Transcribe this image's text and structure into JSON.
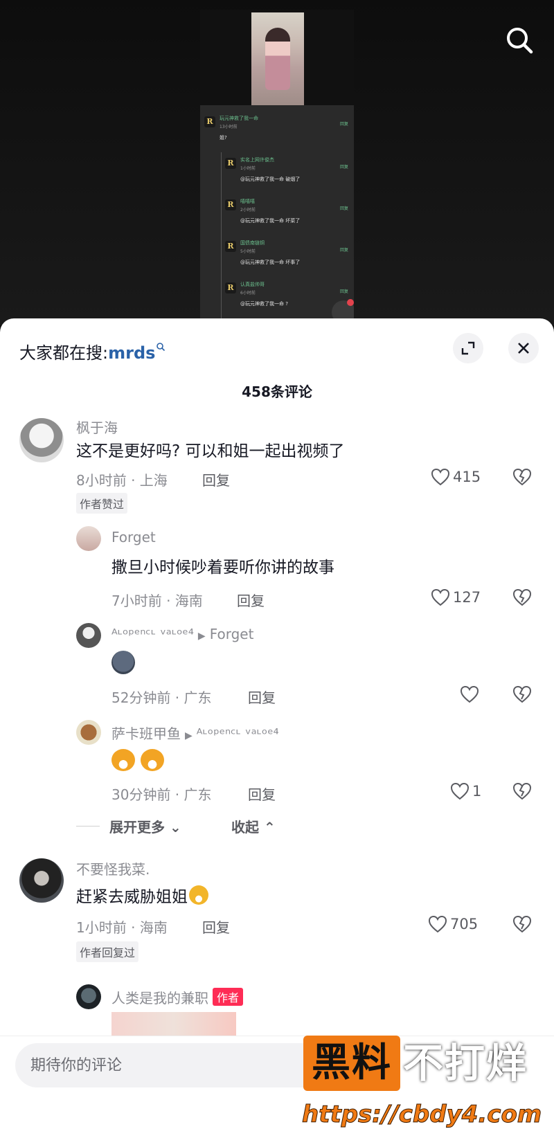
{
  "embedded_screenshot": {
    "items": [
      {
        "name": "玩元神救了我一命",
        "time": "13小时前",
        "text": "姐?",
        "action": "回复"
      },
      {
        "name": "实名上网许俊杰",
        "time": "1小时前",
        "text": "@玩元神救了我一命 破烟了",
        "action": "回复"
      },
      {
        "name": "嘻嘻嘻",
        "time": "2小时前",
        "text": "@玩元神救了我一命 坏菜了",
        "action": "回复"
      },
      {
        "name": "国债南链铜",
        "time": "5小时前",
        "text": "@玩元神救了我一命 坏事了",
        "action": "回复"
      },
      {
        "name": "认真盐帅哥",
        "time": "6小时前",
        "text": "@玩元神救了我一命 ?",
        "action": "回复"
      }
    ],
    "avatar_letter": "R"
  },
  "sheet": {
    "hot_search_prefix": "大家都在搜:",
    "hot_search_keyword": "mrds",
    "comment_count": "458条评论"
  },
  "comments": {
    "c1": {
      "user": "枫于海",
      "text": "这不是更好吗? 可以和姐一起出视频了",
      "meta": "8小时前 · 上海",
      "reply": "回复",
      "likes": "415",
      "tag": "作者赞过"
    },
    "r1": {
      "user": "Forget",
      "text": "撒旦小时候吵着要听你讲的故事",
      "meta": "7小时前 · 海南",
      "reply": "回复",
      "likes": "127"
    },
    "r2": {
      "user": "ᴬᶫᵒᵖᵉⁿᶜᶫ ᵛᵃᶫᵒᵉ⁴",
      "to": "Forget",
      "meta": "52分钟前 · 广东",
      "reply": "回复",
      "likes": ""
    },
    "r3": {
      "user": "萨卡班甲鱼",
      "to": "ᴬᶫᵒᵖᵉⁿᶜᶫ ᵛᵃᶫᵒᵉ⁴",
      "meta": "30分钟前 · 广东",
      "reply": "回复",
      "likes": "1"
    },
    "expand": "展开更多",
    "collapse": "收起",
    "c2": {
      "user": "不要怪我菜.",
      "text": "赶紧去威胁姐姐",
      "meta": "1小时前 · 海南",
      "reply": "回复",
      "likes": "705",
      "tag": "作者回复过"
    },
    "r4": {
      "user": "人类是我的兼职",
      "badge": "作者"
    }
  },
  "input": {
    "placeholder": "期待你的评论"
  },
  "watermark": {
    "brand_a": "黑料",
    "brand_b": "不打烊",
    "url": "https://cbdy4.com"
  },
  "colors": {
    "accent_red": "#fe2c55",
    "link_blue": "#2a62a8",
    "watermark_orange": "#f07a14"
  }
}
